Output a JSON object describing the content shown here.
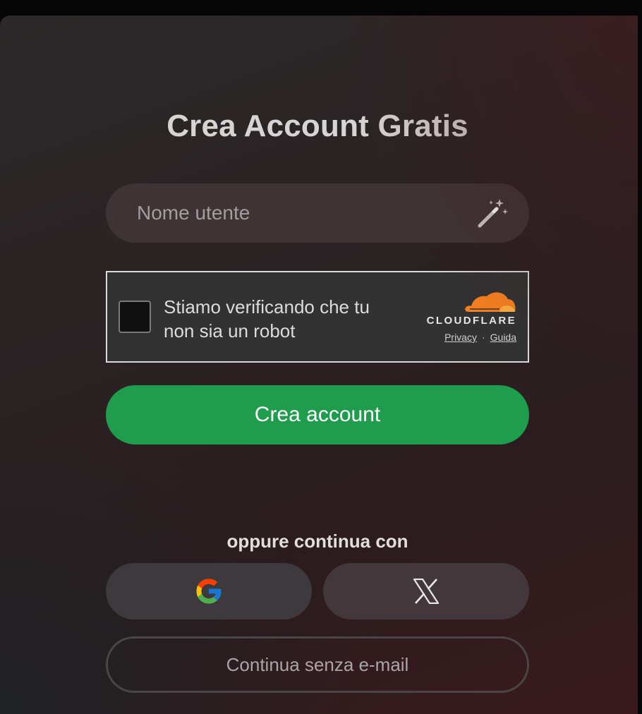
{
  "form": {
    "title": "Crea Account Gratis",
    "username_placeholder": "Nome utente",
    "username_value": "",
    "create_button": "Crea account",
    "or_label": "oppure continua con",
    "no_email_button": "Continua senza e-mail"
  },
  "captcha": {
    "checkbox_label": "Stiamo verificando che tu non sia un robot",
    "provider": "CLOUDFLARE",
    "privacy_link": "Privacy",
    "separator": "·",
    "help_link": "Guida"
  },
  "social": [
    {
      "name": "google",
      "icon": "google-icon"
    },
    {
      "name": "x",
      "icon": "x-icon"
    }
  ],
  "colors": {
    "primary_button": "#1f9d4d",
    "cloudflare_orange": "#f38020",
    "input_bg": "#3e3435"
  }
}
